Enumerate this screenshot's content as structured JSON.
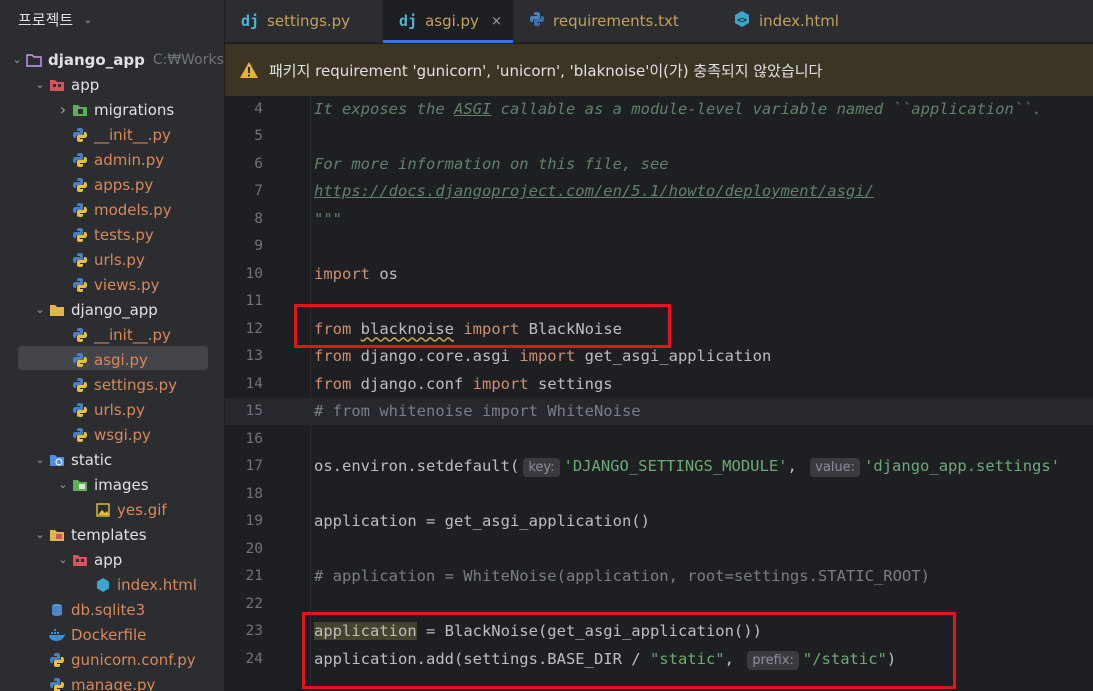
{
  "sidebar": {
    "title": "프로젝트",
    "root": {
      "name": "django_app",
      "path": "C:₩Works"
    },
    "items": [
      {
        "label": "app",
        "depth": 1,
        "icon": "module-folder-icon",
        "arrow": "open",
        "color": "normal"
      },
      {
        "label": "migrations",
        "depth": 2,
        "icon": "package-folder-icon",
        "arrow": "closed",
        "color": "normal"
      },
      {
        "label": "__init__.py",
        "depth": 2,
        "icon": "python-file-icon",
        "color": "orange"
      },
      {
        "label": "admin.py",
        "depth": 2,
        "icon": "python-file-icon",
        "color": "orange"
      },
      {
        "label": "apps.py",
        "depth": 2,
        "icon": "python-file-icon",
        "color": "orange"
      },
      {
        "label": "models.py",
        "depth": 2,
        "icon": "python-file-icon",
        "color": "orange"
      },
      {
        "label": "tests.py",
        "depth": 2,
        "icon": "python-file-icon",
        "color": "orange"
      },
      {
        "label": "urls.py",
        "depth": 2,
        "icon": "python-file-icon",
        "color": "orange"
      },
      {
        "label": "views.py",
        "depth": 2,
        "icon": "python-file-icon",
        "color": "orange"
      },
      {
        "label": "django_app",
        "depth": 1,
        "icon": "folder-icon",
        "arrow": "open",
        "color": "normal"
      },
      {
        "label": "__init__.py",
        "depth": 2,
        "icon": "python-file-icon",
        "color": "orange"
      },
      {
        "label": "asgi.py",
        "depth": 2,
        "icon": "python-file-icon",
        "color": "orange",
        "selected": true
      },
      {
        "label": "settings.py",
        "depth": 2,
        "icon": "python-file-icon",
        "color": "orange"
      },
      {
        "label": "urls.py",
        "depth": 2,
        "icon": "python-file-icon",
        "color": "orange"
      },
      {
        "label": "wsgi.py",
        "depth": 2,
        "icon": "python-file-icon",
        "color": "orange"
      },
      {
        "label": "static",
        "depth": 1,
        "icon": "web-folder-icon",
        "arrow": "open",
        "color": "normal"
      },
      {
        "label": "images",
        "depth": 2,
        "icon": "resource-folder-icon",
        "arrow": "open",
        "color": "normal"
      },
      {
        "label": "yes.gif",
        "depth": 3,
        "icon": "image-file-icon",
        "color": "orange"
      },
      {
        "label": "templates",
        "depth": 1,
        "icon": "template-folder-icon",
        "arrow": "open",
        "color": "normal"
      },
      {
        "label": "app",
        "depth": 2,
        "icon": "module-folder-icon",
        "arrow": "open",
        "color": "normal"
      },
      {
        "label": "index.html",
        "depth": 3,
        "icon": "html-file-icon",
        "color": "orange"
      },
      {
        "label": "db.sqlite3",
        "depth": 1,
        "icon": "database-icon",
        "color": "orange"
      },
      {
        "label": "Dockerfile",
        "depth": 1,
        "icon": "docker-icon",
        "color": "orange"
      },
      {
        "label": "gunicorn.conf.py",
        "depth": 1,
        "icon": "python-file-icon",
        "color": "orange"
      },
      {
        "label": "manage.py",
        "depth": 1,
        "icon": "python-file-icon",
        "color": "orange"
      }
    ]
  },
  "tabs": [
    {
      "label": "settings.py",
      "icon": "dj",
      "active": false
    },
    {
      "label": "asgi.py",
      "icon": "dj",
      "active": true,
      "close": "×"
    },
    {
      "label": "requirements.txt",
      "icon": "python",
      "active": false
    },
    {
      "label": "index.html",
      "icon": "html",
      "active": false
    }
  ],
  "warning": {
    "text": "패키지 requirement 'gunicorn', 'unicorn', 'blaknoise'이(가) 충족되지 않았습니다"
  },
  "editor": {
    "lines": [
      {
        "n": "4"
      },
      {
        "n": "5"
      },
      {
        "n": "6"
      },
      {
        "n": "7"
      },
      {
        "n": "8"
      },
      {
        "n": "9"
      },
      {
        "n": "10"
      },
      {
        "n": "11"
      },
      {
        "n": "12"
      },
      {
        "n": "13"
      },
      {
        "n": "14"
      },
      {
        "n": "15"
      },
      {
        "n": "16"
      },
      {
        "n": "17"
      },
      {
        "n": "18"
      },
      {
        "n": "19"
      },
      {
        "n": "20"
      },
      {
        "n": "21"
      },
      {
        "n": "22"
      },
      {
        "n": "23"
      },
      {
        "n": "24"
      }
    ],
    "t": {
      "l4a": "It exposes the ",
      "l4b": "ASGI",
      "l4c": " callable as a module-level variable named ``application``.",
      "l6": "For more information on this file, see",
      "l7": "https://docs.djangoproject.com/en/5.1/howto/deployment/asgi/",
      "l8": "\"\"\"",
      "l10a": "import",
      "l10b": " os",
      "l12a": "from",
      "l12b": "blacknoise",
      "l12c": "import",
      "l12d": " BlackNoise",
      "l13a": "from",
      "l13b": " django.core.asgi ",
      "l13c": "import",
      "l13d": " get_asgi_application",
      "l14a": "from",
      "l14b": " django.conf ",
      "l14c": "import",
      "l14d": " settings",
      "l15": "# from whitenoise import WhiteNoise",
      "l17a": "os.environ.setdefault(",
      "l17h1": "key:",
      "l17b": "'DJANGO_SETTINGS_MODULE'",
      "l17c": ",",
      "l17h2": "value:",
      "l17d": "'django_app.settings'",
      "l19": "application = get_asgi_application()",
      "l21": "# application = WhiteNoise(application, root=settings.STATIC_ROOT)",
      "l23a": "application",
      "l23b": " = BlackNoise(get_asgi_application())",
      "l24a": "application.add(settings.BASE_DIR / ",
      "l24b": "\"static\"",
      "l24c": ",",
      "l24h": "prefix:",
      "l24d": "\"/static\"",
      "l24e": ")"
    }
  },
  "colors": {
    "annotation_box": "#e0161c",
    "warning_bg": "#3d3524",
    "accent": "#3574f0"
  }
}
